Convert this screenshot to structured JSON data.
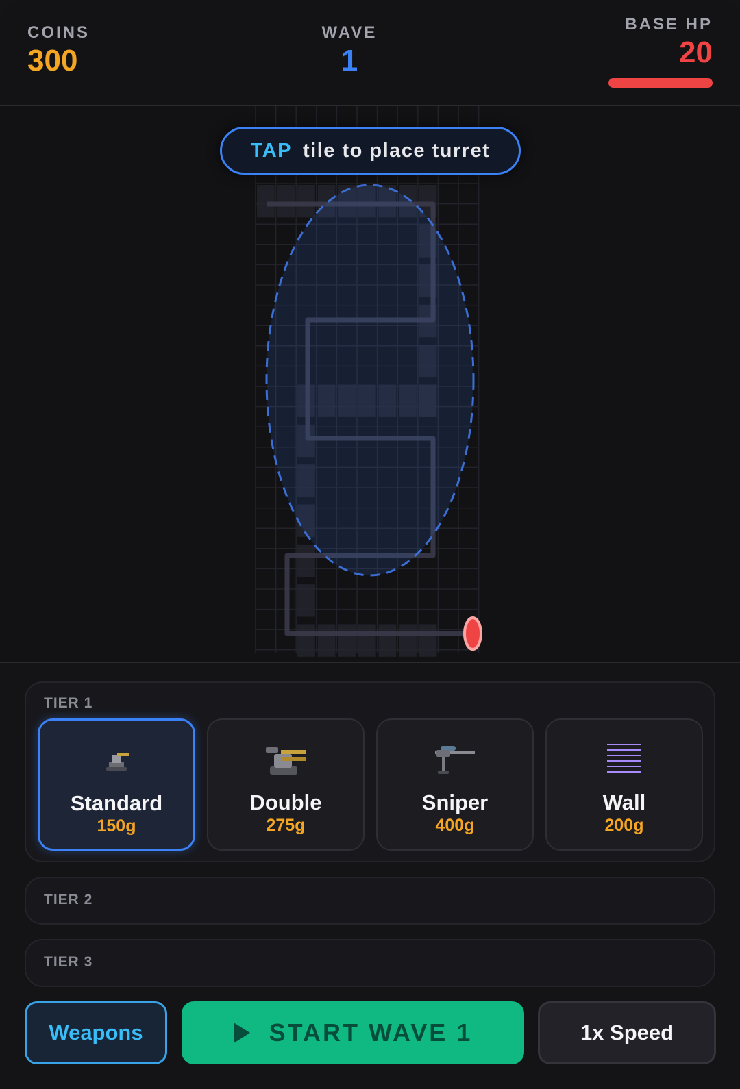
{
  "hud": {
    "coins_label": "COINS",
    "coins_value": "300",
    "wave_label": "WAVE",
    "wave_value": "1",
    "hp_label": "BASE HP",
    "hp_value": "20",
    "hp_fraction": 1.0
  },
  "map": {
    "tip_highlight": "TAP",
    "tip_text": "tile to place turret",
    "range_indicator_color": "#3b82f6",
    "enemy_spawn_color": "#ef4444"
  },
  "tiers": [
    {
      "label": "TIER 1",
      "items": [
        {
          "name": "Standard",
          "price": "150g",
          "icon": "standard-turret-icon",
          "selected": true
        },
        {
          "name": "Double",
          "price": "275g",
          "icon": "double-turret-icon",
          "selected": false
        },
        {
          "name": "Sniper",
          "price": "400g",
          "icon": "sniper-turret-icon",
          "selected": false
        },
        {
          "name": "Wall",
          "price": "200g",
          "icon": "wall-icon",
          "selected": false
        }
      ]
    },
    {
      "label": "TIER 2",
      "items": []
    },
    {
      "label": "TIER 3",
      "items": []
    }
  ],
  "controls": {
    "weapons_label": "Weapons",
    "start_label": "START WAVE 1",
    "speed_label": "1x Speed"
  },
  "colors": {
    "coins": "#f5a524",
    "wave": "#3b82f6",
    "hp": "#ef4444",
    "start_button": "#10b981",
    "accent": "#38bdf8"
  }
}
